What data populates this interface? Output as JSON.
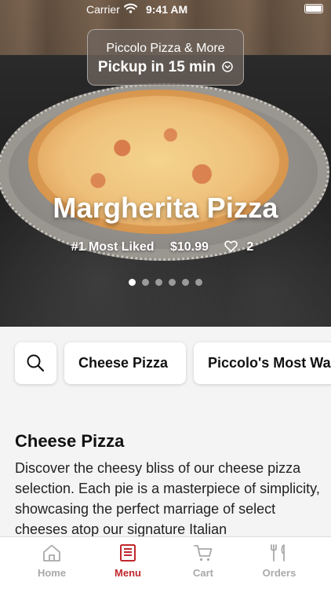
{
  "status_bar": {
    "carrier": "Carrier",
    "time": "9:41 AM"
  },
  "hero": {
    "store_name": "Piccolo Pizza & More",
    "pickup_text": "Pickup in 15 min",
    "item_title": "Margherita Pizza",
    "rank_text": "#1 Most Liked",
    "price": "$10.99",
    "likes": "2",
    "carousel": {
      "count": 6,
      "active_index": 0
    }
  },
  "categories": {
    "search_icon": "search-icon",
    "items": [
      "Cheese Pizza",
      "Piccolo's Most Wanted"
    ]
  },
  "section": {
    "title": "Cheese Pizza",
    "description": "Discover the cheesy bliss of our cheese pizza selection. Each pie is a masterpiece of simplicity, showcasing the perfect marriage of select cheeses atop our signature Italian"
  },
  "tabbar": {
    "items": [
      {
        "label": "Home",
        "icon": "home-icon",
        "active": false
      },
      {
        "label": "Menu",
        "icon": "menu-icon",
        "active": true
      },
      {
        "label": "Cart",
        "icon": "cart-icon",
        "active": false
      },
      {
        "label": "Orders",
        "icon": "orders-icon",
        "active": false
      }
    ]
  },
  "colors": {
    "accent": "#c0282d",
    "tab_inactive": "#a9a9a9"
  }
}
